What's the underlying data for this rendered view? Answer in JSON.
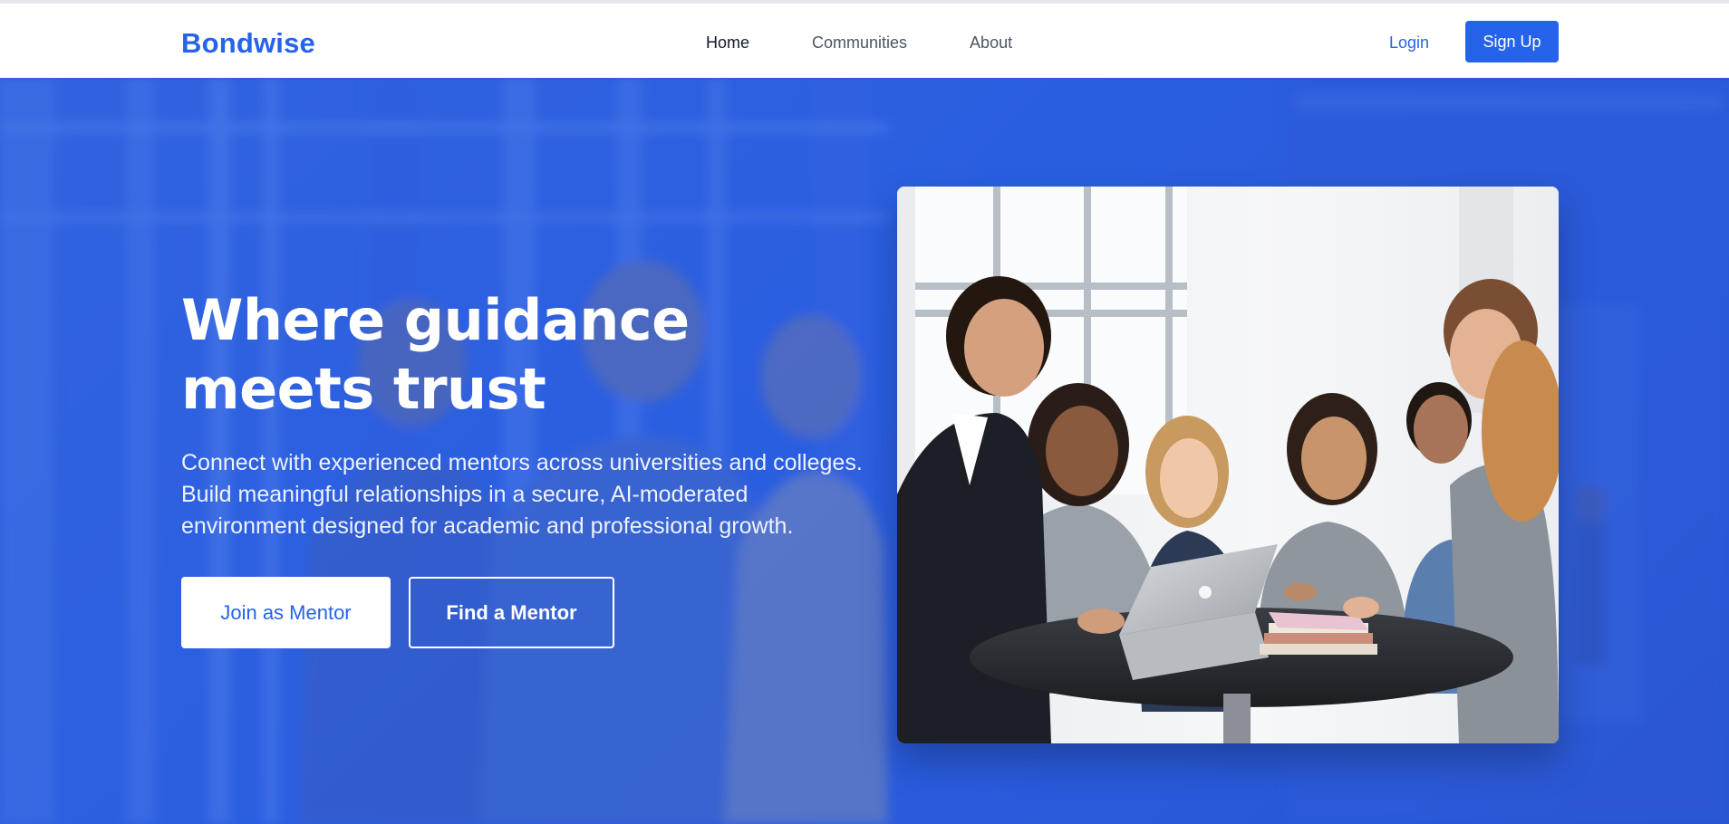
{
  "brand": {
    "name": "Bondwise",
    "color": "#2563eb"
  },
  "nav": {
    "links": [
      {
        "label": "Home",
        "active": true
      },
      {
        "label": "Communities",
        "active": false
      },
      {
        "label": "About",
        "active": false
      }
    ],
    "login_label": "Login",
    "signup_label": "Sign Up"
  },
  "hero": {
    "title": "Where guidance meets trust",
    "subtitle": "Connect with experienced mentors across universities and colleges. Build meaningful relationships in a secure, AI-moderated environment designed for academic and professional growth.",
    "primary_button": "Join as Mentor",
    "secondary_button": "Find a Mentor",
    "background_color": "#2f5ad9",
    "image_icon": "group-meeting-photo-icon"
  }
}
